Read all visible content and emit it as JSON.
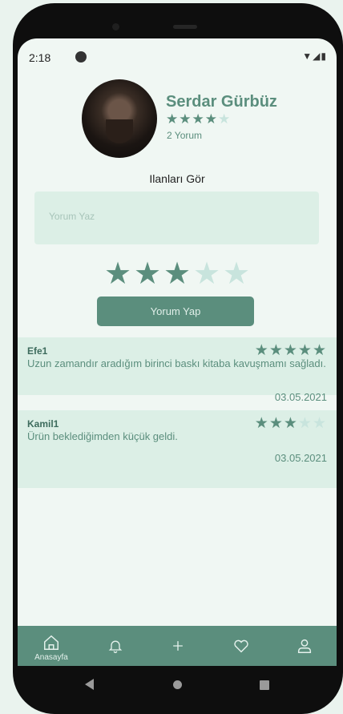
{
  "status_bar": {
    "time": "2:18",
    "icons": "▼◢▮"
  },
  "profile": {
    "name": "Serdar Gürbüz",
    "rating": 4,
    "max_rating": 5,
    "review_count_text": "2 Yorum"
  },
  "listings_link": "Ilanları Gör",
  "comment_input": {
    "placeholder": "Yorum Yaz",
    "value": ""
  },
  "rating_input": {
    "selected": 3,
    "max": 5
  },
  "submit_button": "Yorum Yap",
  "reviews": [
    {
      "user": "Efe1",
      "rating": 5,
      "text": "Uzun zamandır aradığım birinci baskı kitaba kavuşmamı sağladı.",
      "date": "03.05.2021"
    },
    {
      "user": "Kamil1",
      "rating": 3,
      "text": "Ürün beklediğimden küçük geldi.",
      "date": "03.05.2021"
    }
  ],
  "tab_bar": {
    "home_label": "Anasayfa",
    "icons": [
      "home-icon",
      "bell-icon",
      "plus-icon",
      "heart-icon",
      "user-icon"
    ]
  },
  "colors": {
    "primary": "#5b8e7d",
    "light": "#dcefe6",
    "star_off": "#c8e4dd",
    "background": "#f0f7f3"
  }
}
